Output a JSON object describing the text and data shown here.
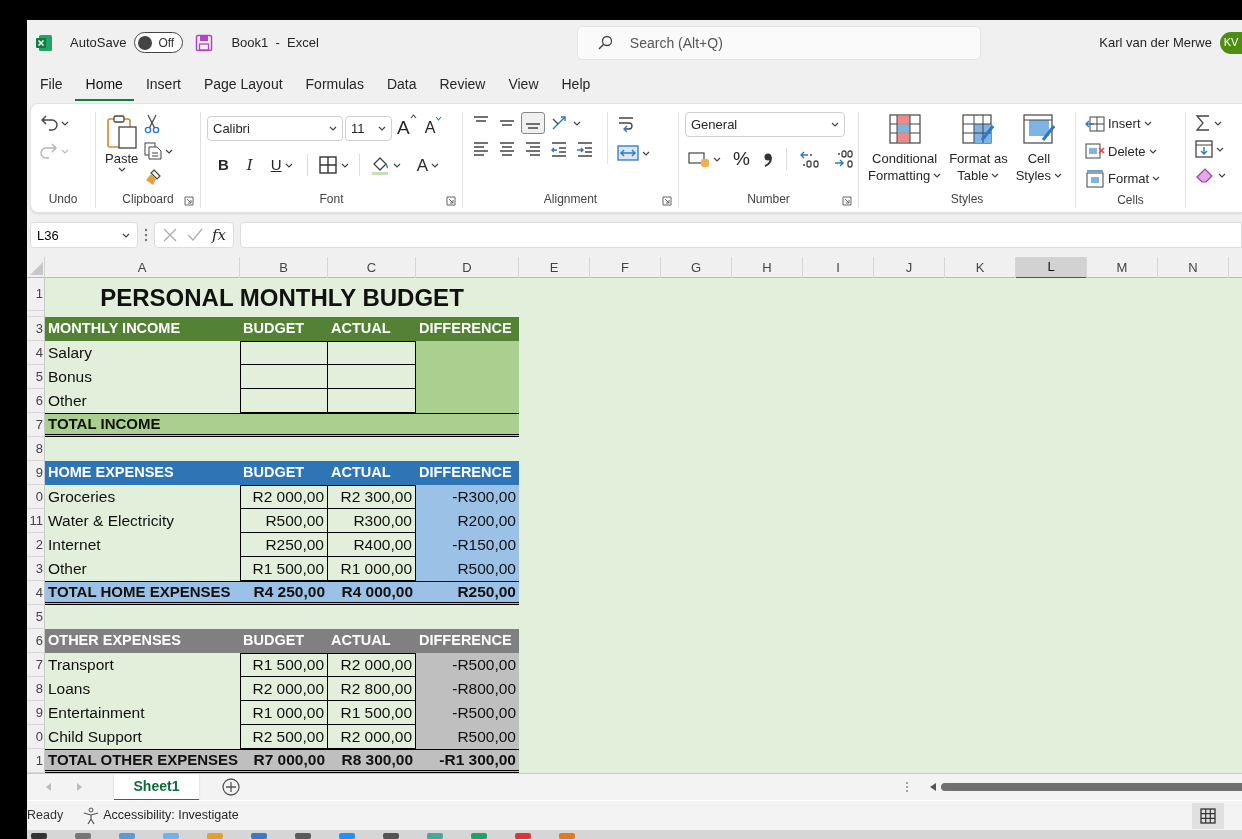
{
  "title_bar": {
    "autosave_label": "AutoSave",
    "autosave": {
      "label": "Off",
      "on": false
    },
    "document_title": "Book1  -  Excel",
    "search": {
      "placeholder": "Search (Alt+Q)"
    },
    "user_name": "Karl van der Merwe",
    "avatar_initials": "KV"
  },
  "menu_tabs": [
    {
      "label": "File",
      "selected": false
    },
    {
      "label": "Home",
      "selected": true
    },
    {
      "label": "Insert",
      "selected": false
    },
    {
      "label": "Page Layout",
      "selected": false
    },
    {
      "label": "Formulas",
      "selected": false
    },
    {
      "label": "Data",
      "selected": false
    },
    {
      "label": "Review",
      "selected": false
    },
    {
      "label": "View",
      "selected": false
    },
    {
      "label": "Help",
      "selected": false
    }
  ],
  "ribbon": {
    "undo": {
      "label": "Undo",
      "buttons": [
        {
          "disabled": false
        },
        {
          "disabled": true
        }
      ]
    },
    "clipboard": {
      "label": "Clipboard",
      "paste_label": "Paste"
    },
    "font": {
      "label": "Font",
      "font_name": "Calibri",
      "font_size": "11",
      "grow_label": "A",
      "shrink_label": "A",
      "style_buttons": [
        "B",
        "I",
        "U"
      ],
      "font_color_label": "A"
    },
    "alignment": {
      "label": "Alignment",
      "vertical_buttons": [
        {
          "selected": false
        },
        {
          "selected": false
        },
        {
          "selected": true
        }
      ]
    },
    "number": {
      "label": "Number",
      "format": "General",
      "percent_label": "%"
    },
    "styles": {
      "label": "Styles",
      "buttons": [
        {
          "line_1": "Conditional",
          "line_2": "Formatting"
        },
        {
          "line_1": "Format as",
          "line_2": "Table"
        },
        {
          "line_1": "Cell",
          "line_2": "Styles"
        }
      ]
    },
    "cells": {
      "label": "Cells",
      "buttons": [
        "Insert",
        "Delete",
        "Format"
      ]
    }
  },
  "formula_bar": {
    "name_box": "L36",
    "function_label": "fx"
  },
  "columns": [
    {
      "letter": "A",
      "selected": false
    },
    {
      "letter": "B",
      "selected": false
    },
    {
      "letter": "C",
      "selected": false
    },
    {
      "letter": "D",
      "selected": false
    },
    {
      "letter": "E",
      "selected": false
    },
    {
      "letter": "F",
      "selected": false
    },
    {
      "letter": "G",
      "selected": false
    },
    {
      "letter": "H",
      "selected": false
    },
    {
      "letter": "I",
      "selected": false
    },
    {
      "letter": "J",
      "selected": false
    },
    {
      "letter": "K",
      "selected": false
    },
    {
      "letter": "L",
      "selected": true
    },
    {
      "letter": "M",
      "selected": false
    },
    {
      "letter": "N",
      "selected": false
    }
  ],
  "row_numbers": [
    "1",
    "3",
    "4",
    "5",
    "6",
    "7",
    "8",
    "9",
    "0",
    "11",
    "2",
    "3",
    "4",
    "5",
    "6",
    "7",
    "8",
    "9",
    "0",
    "1"
  ],
  "sheet": {
    "title": "PERSONAL MONTHLY BUDGET",
    "sections": [
      {
        "kind": "income",
        "color": "#548235",
        "header": [
          "MONTHLY INCOME",
          "BUDGET",
          "ACTUAL",
          "DIFFERENCE"
        ],
        "rows": [
          {
            "label": "Salary"
          },
          {
            "label": "Bonus"
          },
          {
            "label": "Other"
          }
        ],
        "total": {
          "label": "TOTAL INCOME"
        }
      },
      {
        "kind": "home",
        "color": "#2e75b6",
        "header": [
          "HOME EXPENSES",
          "BUDGET",
          "ACTUAL",
          "DIFFERENCE"
        ],
        "rows": [
          {
            "label": "Groceries",
            "budget": "R2 000,00",
            "actual": "R2 300,00",
            "difference": "-R300,00"
          },
          {
            "label": "Water & Electricity",
            "budget": "R500,00",
            "actual": "R300,00",
            "difference": "R200,00"
          },
          {
            "label": "Internet",
            "budget": "R250,00",
            "actual": "R400,00",
            "difference": "-R150,00"
          },
          {
            "label": "Other",
            "budget": "R1 500,00",
            "actual": "R1 000,00",
            "difference": "R500,00"
          }
        ],
        "total": {
          "label": "TOTAL HOME EXPENSES",
          "budget": "R4 250,00",
          "actual": "R4 000,00",
          "difference": "R250,00"
        }
      },
      {
        "kind": "other",
        "color": "#808080",
        "header": [
          "OTHER EXPENSES",
          "BUDGET",
          "ACTUAL",
          "DIFFERENCE"
        ],
        "rows": [
          {
            "label": "Transport",
            "budget": "R1 500,00",
            "actual": "R2 000,00",
            "difference": "-R500,00"
          },
          {
            "label": "Loans",
            "budget": "R2 000,00",
            "actual": "R2 800,00",
            "difference": "-R800,00"
          },
          {
            "label": "Entertainment",
            "budget": "R1 000,00",
            "actual": "R1 500,00",
            "difference": "-R500,00"
          },
          {
            "label": "Child Support",
            "budget": "R2 500,00",
            "actual": "R2 000,00",
            "difference": "R500,00"
          }
        ],
        "total": {
          "label": "TOTAL OTHER EXPENSES",
          "budget": "R7 000,00",
          "actual": "R8 300,00",
          "difference": "-R1 300,00"
        }
      }
    ]
  },
  "sheet_tabs": [
    {
      "label": "Sheet1",
      "selected": true
    }
  ],
  "status_bar": {
    "ready": "Ready",
    "accessibility": "Accessibility: Investigate"
  }
}
